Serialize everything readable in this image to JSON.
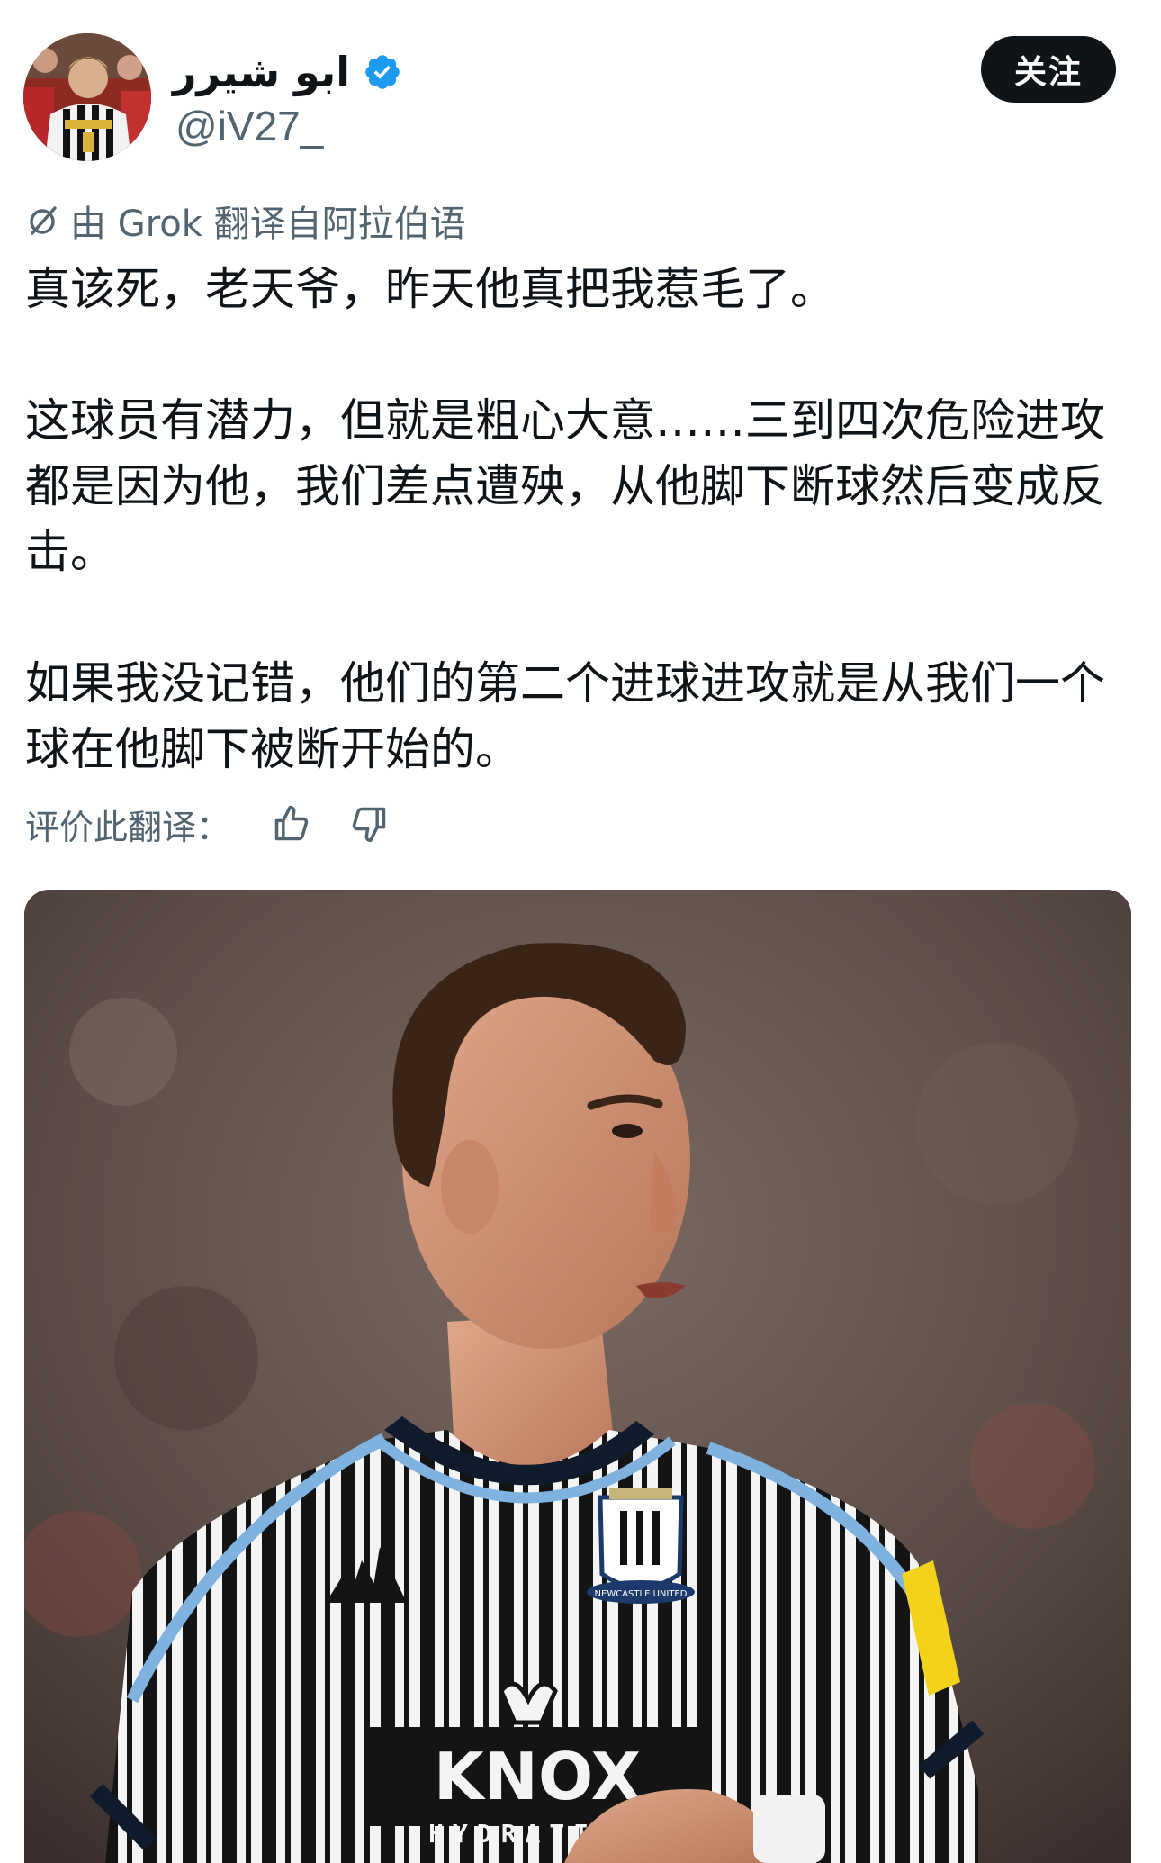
{
  "author": {
    "display_name": "ابو شيرر",
    "handle": "@iV27_",
    "verified": true,
    "avatar_icon": "avatar-icon"
  },
  "follow_label": "关注",
  "translation_notice": "由 Grok 翻译自阿拉伯语",
  "tweet": {
    "paragraphs": [
      "真该死，老天爷，昨天他真把我惹毛了。",
      "这球员有潜力，但就是粗心大意……三到四次危险进攻都是因为他，我们差点遭殃，从他脚下断球然后变成反击。",
      "如果我没记错，他们的第二个进球进攻就是从我们一个球在他脚下被断开始的。"
    ]
  },
  "rating": {
    "label": "评价此翻译：",
    "thumbs_up_icon": "thumbs-up-icon",
    "thumbs_down_icon": "thumbs-down-icon"
  },
  "media": {
    "kit_text_main": "KNOX",
    "kit_text_sub": "HYDRATION",
    "badge_text": "NEWCASTLE UNITED"
  },
  "colors": {
    "verified_blue": "#1d9bf0",
    "text_primary": "#0f1419",
    "text_secondary": "#536471",
    "button_bg": "#0f1419"
  }
}
